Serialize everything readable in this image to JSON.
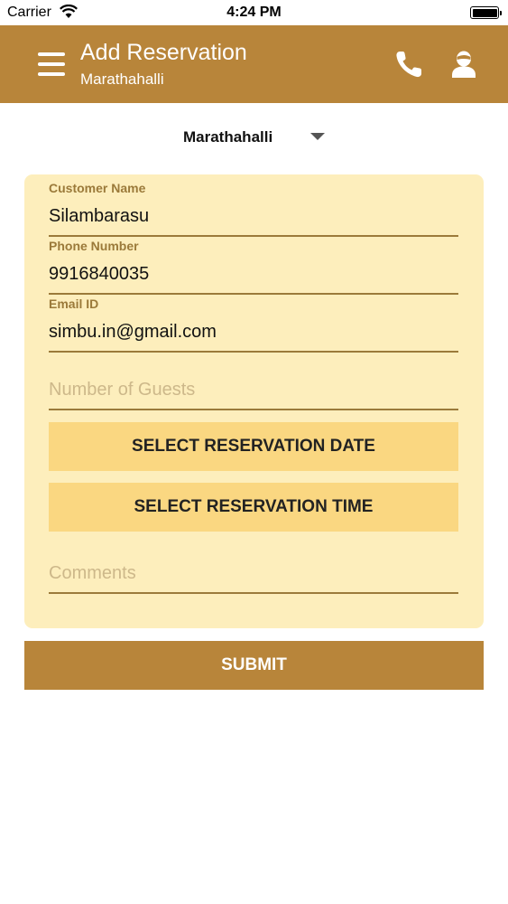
{
  "status_bar": {
    "carrier": "Carrier",
    "time": "4:24 PM",
    "icons": [
      "wifi-icon",
      "battery-icon"
    ]
  },
  "header": {
    "title": "Add Reservation",
    "subtitle": "Marathahalli",
    "icons": [
      "menu-icon",
      "phone-icon",
      "profile-icon"
    ]
  },
  "location": {
    "selected": "Marathahalli"
  },
  "form": {
    "customer_name": {
      "label": "Customer Name",
      "value": "Silambarasu"
    },
    "phone_number": {
      "label": "Phone Number",
      "value": "9916840035"
    },
    "email": {
      "label": "Email ID",
      "value": "simbu.in@gmail.com"
    },
    "guests": {
      "placeholder": "Number of Guests",
      "value": ""
    },
    "select_date_label": "SELECT RESERVATION DATE",
    "select_time_label": "SELECT RESERVATION TIME",
    "comments": {
      "placeholder": "Comments",
      "value": ""
    }
  },
  "submit_label": "SUBMIT",
  "colors": {
    "brand": "#b8853a",
    "card_bg": "#fdeebc",
    "button_bg": "#fad781",
    "label_color": "#9b7a3a",
    "underline": "#9b7a3a"
  }
}
